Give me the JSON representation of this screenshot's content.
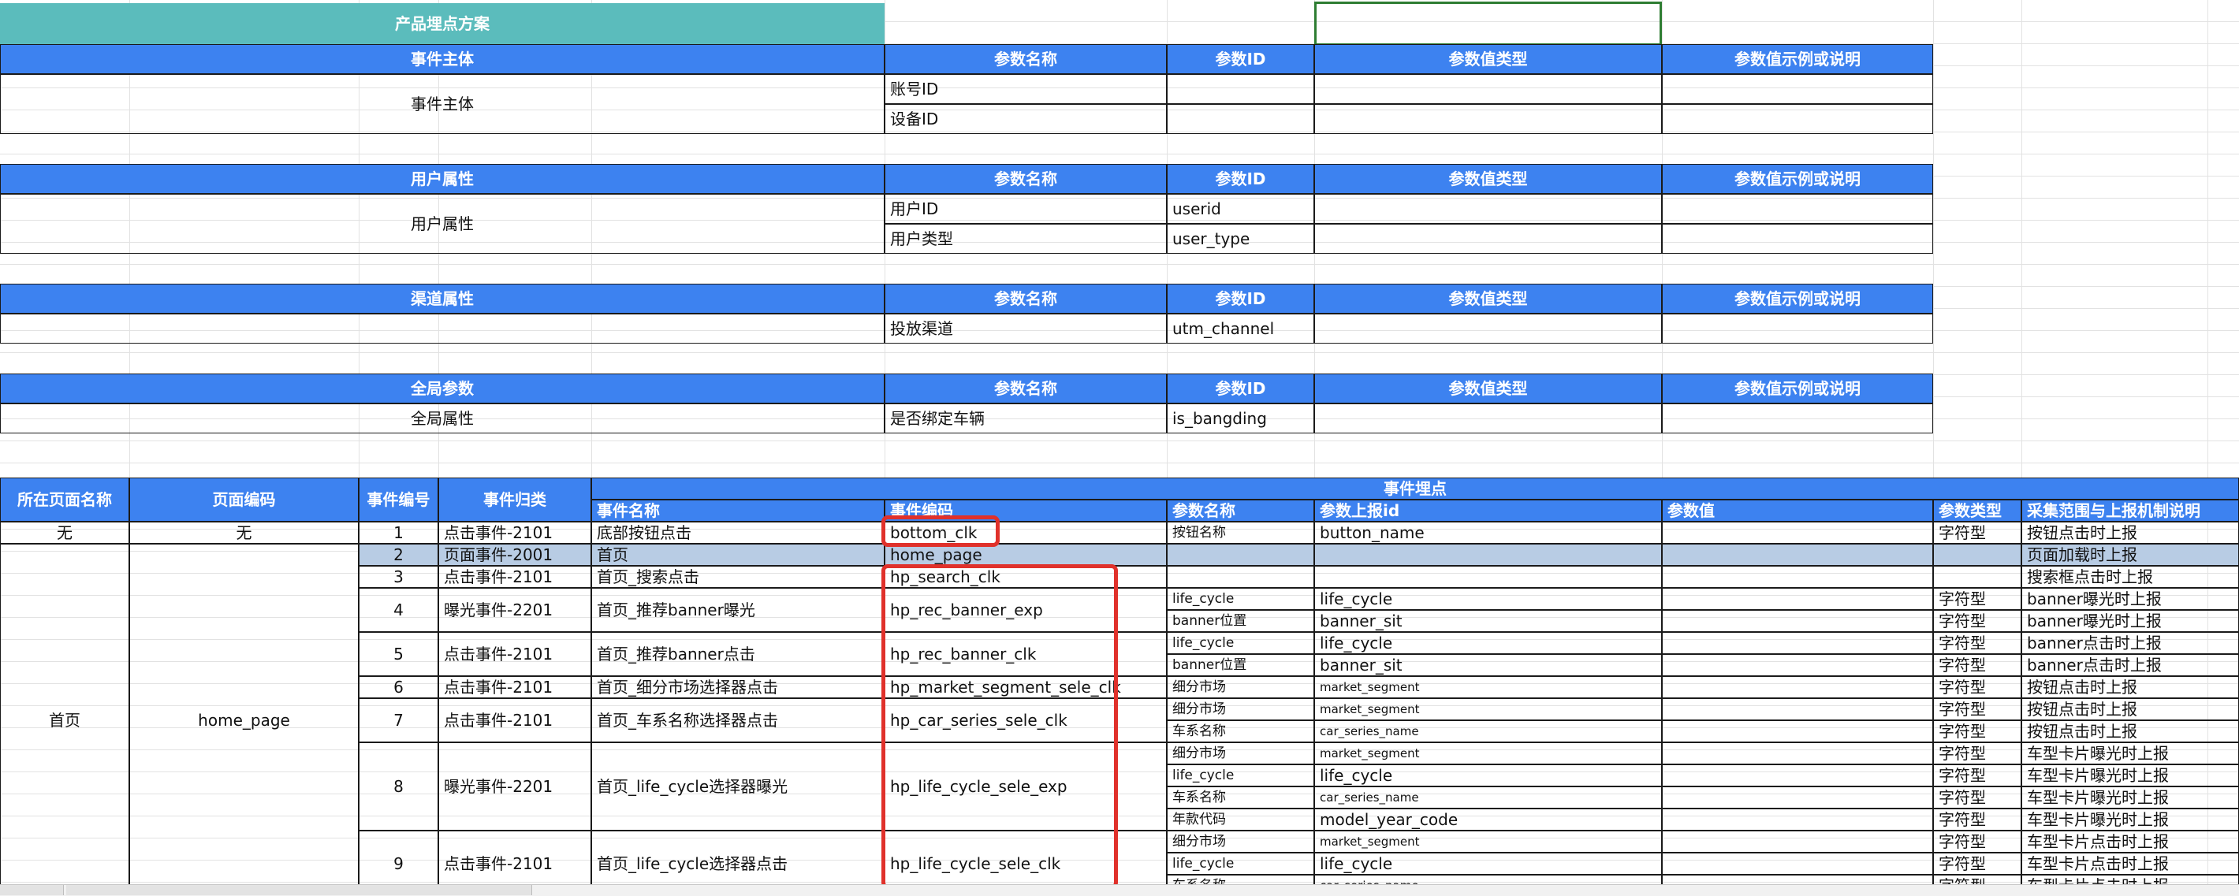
{
  "title": "产品埋点方案",
  "param_header": {
    "name": "参数名称",
    "id": "参数ID",
    "type": "参数值类型",
    "example": "参数值示例或说明"
  },
  "sections": [
    {
      "title": "事件主体",
      "label": "事件主体",
      "rows": [
        {
          "name": "账号ID",
          "id": ""
        },
        {
          "name": "设备ID",
          "id": ""
        }
      ]
    },
    {
      "title": "用户属性",
      "label": "用户属性",
      "rows": [
        {
          "name": "用户ID",
          "id": "userid"
        },
        {
          "name": "用户类型",
          "id": "user_type"
        }
      ]
    },
    {
      "title": "渠道属性",
      "label": "",
      "rows": [
        {
          "name": "投放渠道",
          "id": "utm_channel"
        }
      ]
    },
    {
      "title": "全局参数",
      "label": "全局属性",
      "rows": [
        {
          "name": "是否绑定车辆",
          "id": "is_bangding"
        }
      ]
    }
  ],
  "events_table": {
    "group_header": "事件埋点",
    "headers": {
      "page_name": "所在页面名称",
      "page_code": "页面编码",
      "event_no": "事件编号",
      "event_category": "事件归类",
      "event_name": "事件名称",
      "event_code": "事件编码",
      "param_name": "参数名称",
      "param_report_id": "参数上报id",
      "param_value": "参数值",
      "param_type": "参数类型",
      "collect_desc": "采集范围与上报机制说明"
    },
    "first_row": {
      "page_name": "无",
      "page_code": "无"
    },
    "home": {
      "page_name": "首页",
      "page_code": "home_page"
    },
    "events": [
      {
        "no": "1",
        "category": "点击事件-2101",
        "name": "底部按钮点击",
        "code": "bottom_clk",
        "params": [
          {
            "name": "按钮名称",
            "id": "button_name",
            "type": "字符型",
            "desc": "按钮点击时上报"
          }
        ]
      },
      {
        "no": "2",
        "category": "页面事件-2001",
        "name": "首页",
        "code": "home_page",
        "params": [
          {
            "name": "",
            "id": "",
            "type": "",
            "desc": "页面加载时上报"
          }
        ]
      },
      {
        "no": "3",
        "category": "点击事件-2101",
        "name": "首页_搜索点击",
        "code": "hp_search_clk",
        "params": [
          {
            "name": "",
            "id": "",
            "type": "",
            "desc": "搜索框点击时上报"
          }
        ]
      },
      {
        "no": "4",
        "category": "曝光事件-2201",
        "name": "首页_推荐banner曝光",
        "code": "hp_rec_banner_exp",
        "params": [
          {
            "name": "life_cycle",
            "id": "life_cycle",
            "type": "字符型",
            "desc": "banner曝光时上报"
          },
          {
            "name": "banner位置",
            "id": "banner_sit",
            "type": "字符型",
            "desc": "banner曝光时上报"
          }
        ]
      },
      {
        "no": "5",
        "category": "点击事件-2101",
        "name": "首页_推荐banner点击",
        "code": "hp_rec_banner_clk",
        "params": [
          {
            "name": "life_cycle",
            "id": "life_cycle",
            "type": "字符型",
            "desc": "banner点击时上报"
          },
          {
            "name": "banner位置",
            "id": "banner_sit",
            "type": "字符型",
            "desc": "banner点击时上报"
          }
        ]
      },
      {
        "no": "6",
        "category": "点击事件-2101",
        "name": "首页_细分市场选择器点击",
        "code": "hp_market_segment_sele_clk",
        "params": [
          {
            "name": "细分市场",
            "id": "market_segment",
            "type": "字符型",
            "desc": "按钮点击时上报"
          }
        ]
      },
      {
        "no": "7",
        "category": "点击事件-2101",
        "name": "首页_车系名称选择器点击",
        "code": "hp_car_series_sele_clk",
        "params": [
          {
            "name": "细分市场",
            "id": "market_segment",
            "type": "字符型",
            "desc": "按钮点击时上报"
          },
          {
            "name": "车系名称",
            "id": "car_series_name",
            "type": "字符型",
            "desc": "按钮点击时上报"
          }
        ]
      },
      {
        "no": "8",
        "category": "曝光事件-2201",
        "name": "首页_life_cycle选择器曝光",
        "code": "hp_life_cycle_sele_exp",
        "params": [
          {
            "name": "细分市场",
            "id": "market_segment",
            "type": "字符型",
            "desc": "车型卡片曝光时上报"
          },
          {
            "name": "life_cycle",
            "id": "life_cycle",
            "type": "字符型",
            "desc": "车型卡片曝光时上报"
          },
          {
            "name": "车系名称",
            "id": "car_series_name",
            "type": "字符型",
            "desc": "车型卡片曝光时上报"
          },
          {
            "name": "年款代码",
            "id": "model_year_code",
            "type": "字符型",
            "desc": "车型卡片曝光时上报"
          }
        ]
      },
      {
        "no": "9",
        "category": "点击事件-2101",
        "name": "首页_life_cycle选择器点击",
        "code": "hp_life_cycle_sele_clk",
        "params": [
          {
            "name": "细分市场",
            "id": "market_segment",
            "type": "字符型",
            "desc": "车型卡片点击时上报"
          },
          {
            "name": "life_cycle",
            "id": "life_cycle",
            "type": "字符型",
            "desc": "车型卡片点击时上报"
          },
          {
            "name": "车系名称",
            "id": "car_series_name",
            "type": "字符型",
            "desc": "车型卡片点击时上报"
          }
        ]
      }
    ]
  }
}
